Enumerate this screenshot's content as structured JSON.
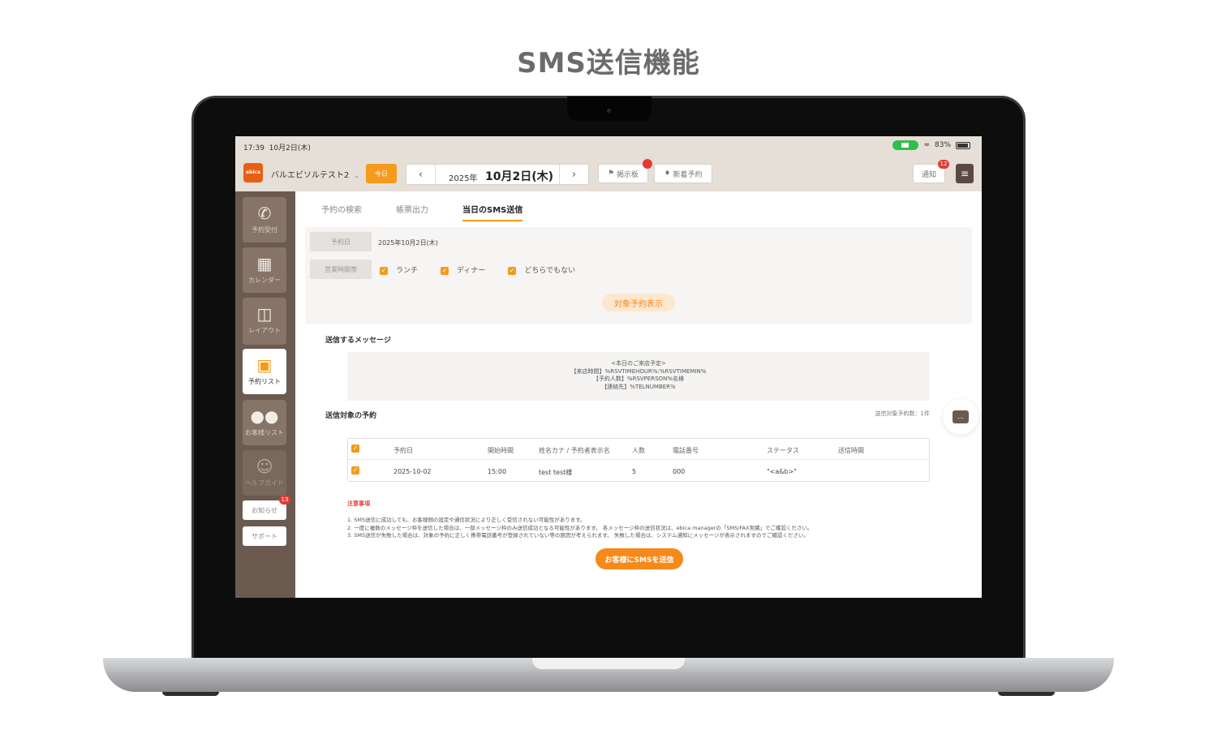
{
  "heading": "SMS送信機能",
  "status": {
    "time": "17:39",
    "date": "10月2日(木)",
    "battery": "83%"
  },
  "topbar": {
    "logo": "ebica",
    "store": "バルエビソルテスト2",
    "today": "今日",
    "year": "2025年",
    "date": "10月2日(木)",
    "board": "掲示板",
    "new_reservation": "新着予約",
    "notify": "通知",
    "notify_count": "12"
  },
  "sidebar": {
    "items": [
      {
        "label": "予約受付",
        "icon": "phone-icon"
      },
      {
        "label": "カレンダー",
        "icon": "calendar-icon"
      },
      {
        "label": "レイアウト",
        "icon": "layout-icon"
      },
      {
        "label": "予約リスト",
        "icon": "book-icon"
      },
      {
        "label": "お客様リスト",
        "icon": "users-icon"
      },
      {
        "label": "ヘルプガイド",
        "icon": "guide-icon"
      }
    ],
    "news": "お知らせ",
    "news_count": "13",
    "support": "サポート"
  },
  "tabs": [
    "予約の検索",
    "帳票出力",
    "当日のSMS送信"
  ],
  "filter": {
    "date_label": "予約日",
    "date_value": "2025年10月2日(木)",
    "time_label": "営業時間帯",
    "options": [
      "ランチ",
      "ディナー",
      "どちらでもない"
    ],
    "show_button": "対象予約表示"
  },
  "message": {
    "title": "送信するメッセージ",
    "lines": [
      "<本日のご来店予定>",
      "【来店時間】%RSVTIMEHOUR%:%RSVTIMEMIN%",
      "【予約人数】%RSVPERSON%名様",
      "【連絡先】%TELNUMBER%"
    ]
  },
  "targets": {
    "title": "送信対象の予約",
    "count": "送信対象予約数：1件",
    "headers": [
      "予約日",
      "開始時間",
      "姓名カナ / 予約者表示名",
      "人数",
      "電話番号",
      "ステータス",
      "送信時間"
    ],
    "rows": [
      [
        "2025-10-02",
        "15:00",
        "test test様",
        "5",
        "000",
        "\"<a&b>\"",
        ""
      ]
    ]
  },
  "notes": {
    "title": "注意事項",
    "items": [
      "1. SMS送信に成功しても、お客様側の設定や通信状況により正しく受信されない可能性があります。",
      "2. 一度に複数のメッセージ枠を送信した場合は、一部メッセージ枠のみ送信成功となる可能性があります。 各メッセージ枠の送信状況は、ebica managerの「SMS/FAX実績」でご確認ください。",
      "3. SMS送信が失敗した場合は、対象の予約に正しく携帯電話番号が登録されていない等の原因が考えられます。 失敗した場合は、システム通知にメッセージが表示されますのでご確認ください。"
    ]
  },
  "send_button": "お客様にSMSを送信",
  "colors": {
    "accent": "#f59a1a",
    "sidebar": "#6b5a50",
    "topbar": "#e6dfd7",
    "alert": "#e53935"
  }
}
